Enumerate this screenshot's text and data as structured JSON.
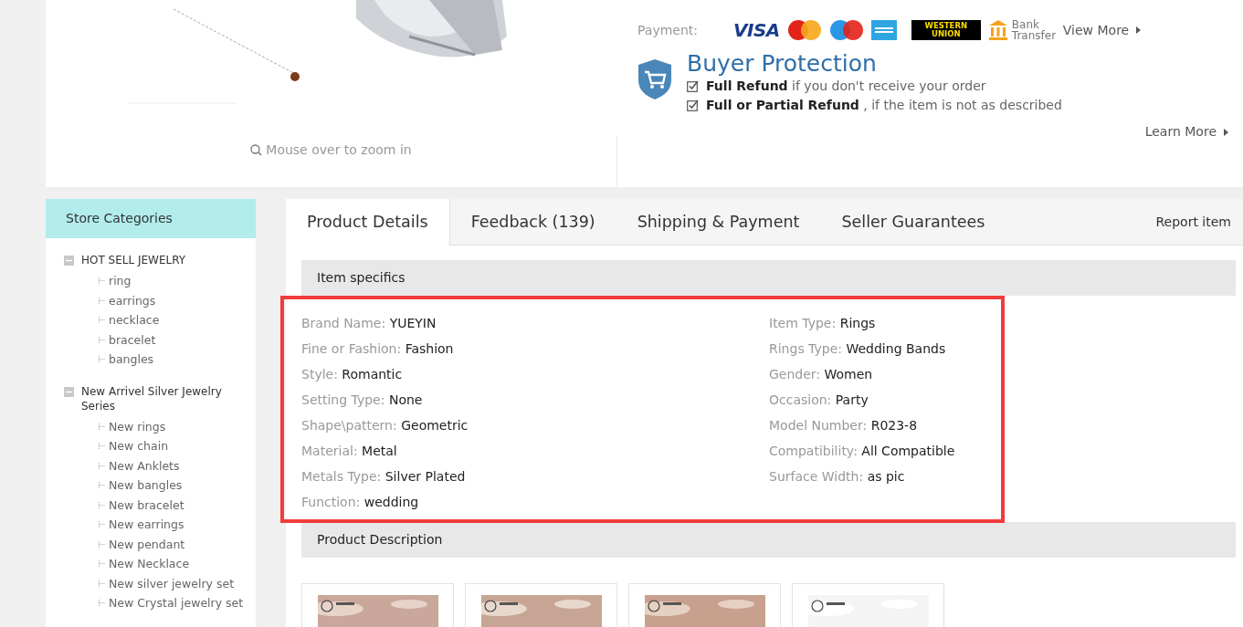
{
  "gallery": {
    "zoom_hint": "Mouse over to zoom in"
  },
  "payment": {
    "label": "Payment:",
    "methods": [
      {
        "kind": "visa",
        "text": "VISA"
      },
      {
        "kind": "mastercard"
      },
      {
        "kind": "maestro"
      },
      {
        "kind": "amex"
      },
      {
        "kind": "western",
        "text": "WESTERN UNION"
      },
      {
        "kind": "bank",
        "text": "Bank Transfer"
      }
    ],
    "more": "View More"
  },
  "protection": {
    "title": "Buyer Protection",
    "items": [
      {
        "text": "**Full Refund** if you don't receive your order"
      },
      {
        "text": "**Full or Partial Refund** , if the item is not as described"
      }
    ],
    "more": "Learn More"
  },
  "sidebar": {
    "title": "Store Categories",
    "groups": [
      {
        "label": "HOT SELL JEWELRY",
        "expanded": true,
        "children": [
          {
            "label": "ring"
          },
          {
            "label": "earrings"
          },
          {
            "label": "necklace"
          },
          {
            "label": "bracelet"
          },
          {
            "label": "bangles"
          }
        ]
      },
      {
        "label": "New Arrivel Silver Jewelry Series",
        "expanded": true,
        "children": [
          {
            "label": "New rings"
          },
          {
            "label": "New chain"
          },
          {
            "label": "New Anklets"
          },
          {
            "label": "New bangles"
          },
          {
            "label": "New bracelet"
          },
          {
            "label": "New earrings"
          },
          {
            "label": "New pendant"
          },
          {
            "label": "New Necklace"
          },
          {
            "label": "New silver jewelry set"
          },
          {
            "label": "New Crystal jewelry set"
          }
        ]
      }
    ]
  },
  "tabs": [
    {
      "label": "Product Details",
      "selected": true
    },
    {
      "label": "Feedback (139)",
      "selected": false
    },
    {
      "label": "Shipping & Payment",
      "selected": false
    },
    {
      "label": "Seller Guarantees",
      "selected": false
    }
  ],
  "report": "Report item",
  "specifics": {
    "title": "Item specifics",
    "columns": [
      [
        {
          "name": "Brand Name:",
          "value": "YUEYIN"
        },
        {
          "name": "Fine or Fashion:",
          "value": "Fashion"
        },
        {
          "name": "Style:",
          "value": "Romantic"
        },
        {
          "name": "Setting Type:",
          "value": "None"
        },
        {
          "name": "Shape\\pattern:",
          "value": "Geometric"
        },
        {
          "name": "Material:",
          "value": "Metal"
        },
        {
          "name": "Metals Type:",
          "value": "Silver Plated"
        },
        {
          "name": "Function:",
          "value": "wedding"
        }
      ],
      [
        {
          "name": "Item Type:",
          "value": "Rings"
        },
        {
          "name": "Rings Type:",
          "value": "Wedding Bands"
        },
        {
          "name": "Gender:",
          "value": "Women"
        },
        {
          "name": "Occasion:",
          "value": "Party"
        },
        {
          "name": "Model Number:",
          "value": "R023-8"
        },
        {
          "name": "Compatibility:",
          "value": "All Compatible"
        },
        {
          "name": "Surface Width:",
          "value": "as pic"
        }
      ]
    ]
  },
  "description": {
    "title": "Product Description"
  }
}
